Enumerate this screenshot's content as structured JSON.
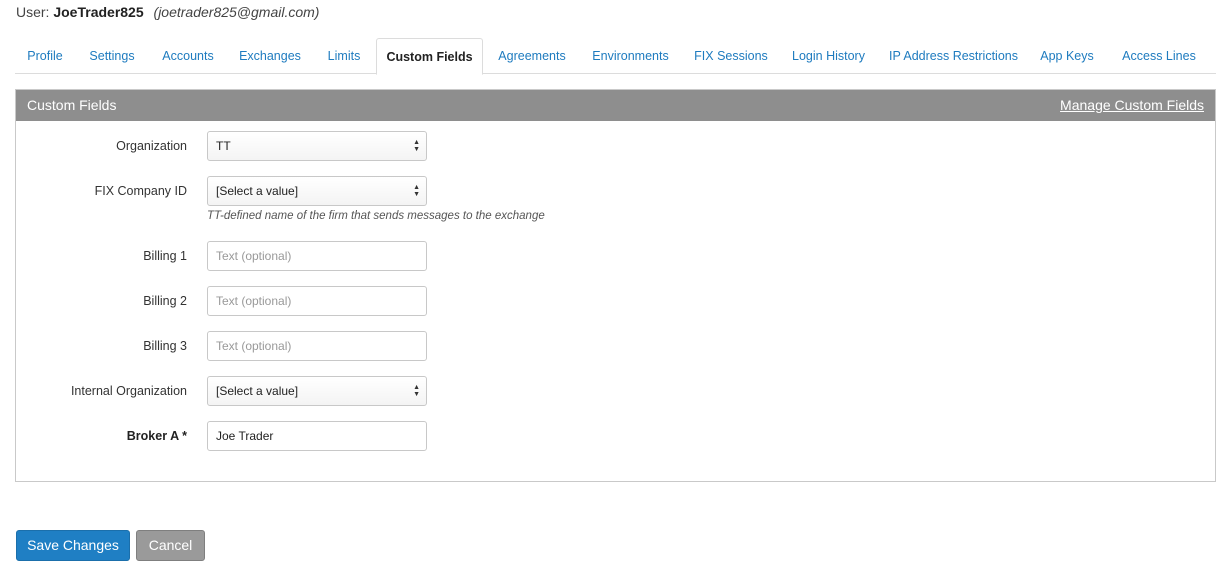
{
  "user": {
    "prefix": "User:",
    "name": "JoeTrader825",
    "email": "(joetrader825@gmail.com)"
  },
  "tabs": [
    {
      "label": "Profile"
    },
    {
      "label": "Settings"
    },
    {
      "label": "Accounts"
    },
    {
      "label": "Exchanges"
    },
    {
      "label": "Limits"
    },
    {
      "label": "Custom Fields",
      "active": true
    },
    {
      "label": "Agreements"
    },
    {
      "label": "Environments"
    },
    {
      "label": "FIX Sessions"
    },
    {
      "label": "Login History"
    },
    {
      "label": "IP Address Restrictions"
    },
    {
      "label": "App Keys"
    },
    {
      "label": "Access Lines"
    }
  ],
  "panel": {
    "title": "Custom Fields",
    "manage_link": "Manage Custom Fields"
  },
  "fields": {
    "organization": {
      "label": "Organization",
      "value": "TT"
    },
    "fix_company_id": {
      "label": "FIX Company ID",
      "value": "[Select a value]",
      "hint": "TT-defined name of the firm that sends messages to the exchange"
    },
    "billing1": {
      "label": "Billing 1",
      "placeholder": "Text (optional)"
    },
    "billing2": {
      "label": "Billing 2",
      "placeholder": "Text (optional)"
    },
    "billing3": {
      "label": "Billing 3",
      "placeholder": "Text (optional)"
    },
    "internal_org": {
      "label": "Internal Organization",
      "value": "[Select a value]"
    },
    "broker_a": {
      "label": "Broker A *",
      "value": "Joe Trader"
    }
  },
  "buttons": {
    "save": "Save Changes",
    "cancel": "Cancel"
  },
  "colors": {
    "accent": "#1f7fc4",
    "panel_header": "#8e8e8e",
    "link": "#1e7bbf"
  }
}
